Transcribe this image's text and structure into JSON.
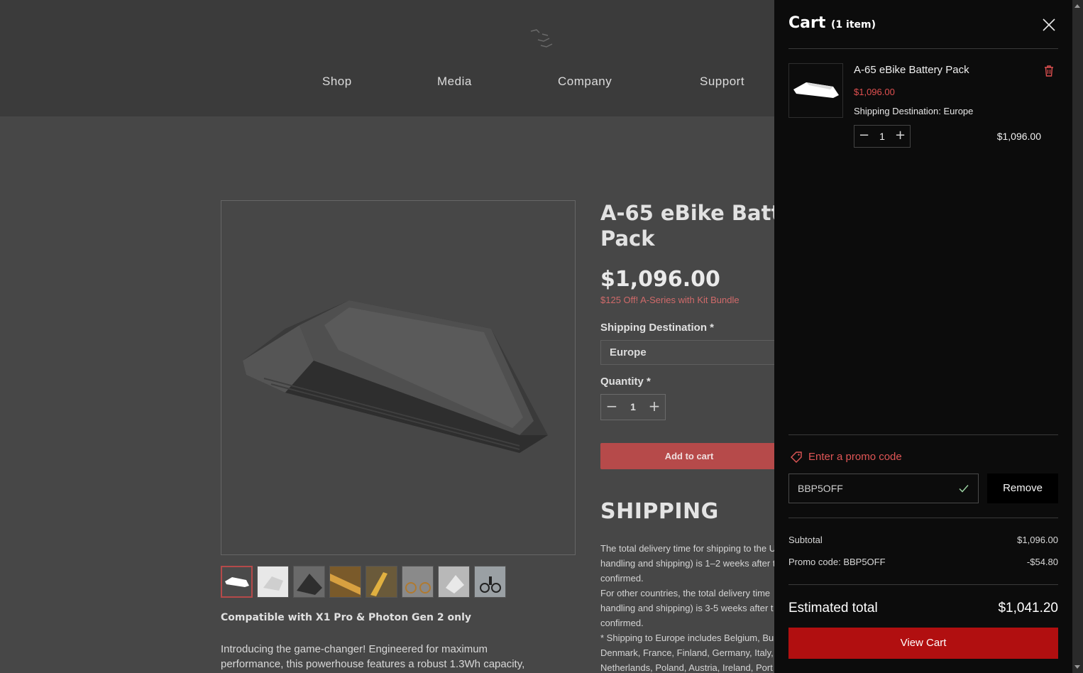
{
  "nav": {
    "items": [
      {
        "label": "Shop"
      },
      {
        "label": "Media"
      },
      {
        "label": "Company"
      },
      {
        "label": "Support"
      }
    ]
  },
  "product": {
    "title_line1": "A-65 eBike Batt",
    "title_line2": "Pack",
    "price": "$1,096.00",
    "promo_note": "$125 Off! A-Series with Kit Bundle",
    "shipping_label": "Shipping Destination *",
    "shipping_value": "Europe",
    "quantity_label": "Quantity *",
    "quantity": "1",
    "add_to_cart": "Add to cart",
    "shipping_heading": "SHIPPING",
    "shipping_lines": [
      "The total delivery time for shipping to the U",
      "handling and shipping) is 1–2 weeks after t",
      "confirmed.",
      "For other countries, the total delivery time",
      "handling and shipping) is 3-5 weeks after t",
      "confirmed.",
      "* Shipping to Europe includes Belgium, Bu",
      "Denmark, France, Finland, Germany, Italy,",
      "Netherlands, Poland, Austria, Ireland, Port"
    ],
    "compatible": "Compatible with X1 Pro & Photon Gen 2 only",
    "intro_line1": "Introducing the game-changer! Engineered for maximum",
    "intro_line2": "performance, this powerhouse features a robust 1.3Wh capacity,"
  },
  "cart": {
    "title": "Cart",
    "count": "(1 item)",
    "item": {
      "name": "A-65 eBike Battery Pack",
      "price": "$1,096.00",
      "option": "Shipping Destination: Europe",
      "quantity": "1",
      "total": "$1,096.00"
    },
    "promo_link": "Enter a promo code",
    "promo_code": "BBP5OFF",
    "remove": "Remove",
    "subtotal_label": "Subtotal",
    "subtotal_value": "$1,096.00",
    "discount_label": "Promo code: BBP5OFF",
    "discount_value": "-$54.80",
    "estimated_label": "Estimated total",
    "estimated_value": "$1,041.20",
    "view_cart": "View Cart"
  },
  "colors": {
    "accent_red": "#b10f10",
    "price_red": "#e05050",
    "drawer_bg": "#0c0c0c"
  }
}
